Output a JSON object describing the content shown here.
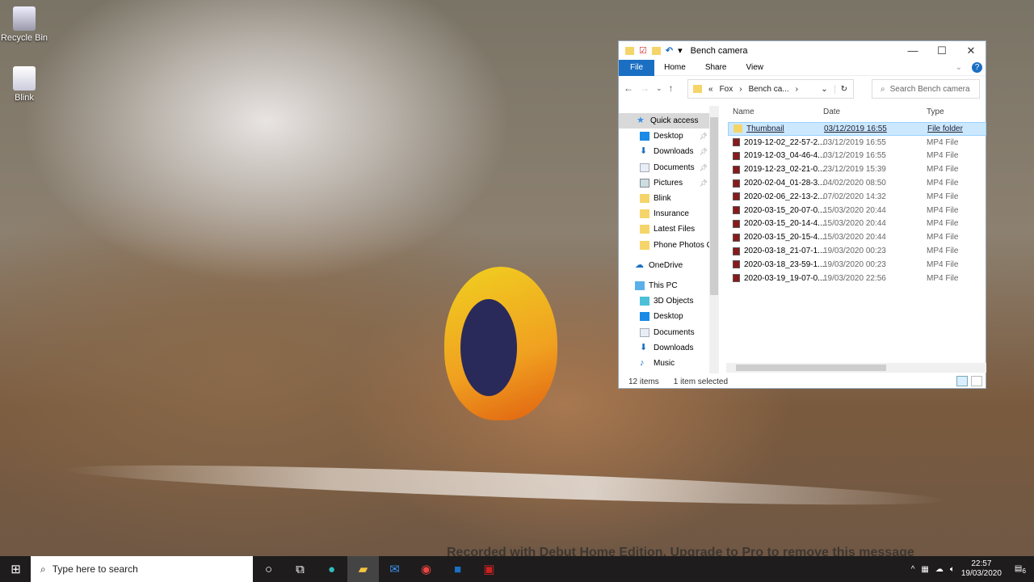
{
  "desktop": {
    "icons": [
      {
        "label": "Recycle Bin",
        "icon": "recycle-bin-icon"
      },
      {
        "label": "Blink",
        "icon": "file-icon"
      }
    ]
  },
  "explorer": {
    "title": "Bench camera",
    "ribbon_tabs": [
      "File",
      "Home",
      "Share",
      "View"
    ],
    "breadcrumb": {
      "overflow": "«",
      "items": [
        "Fox",
        "Bench ca..."
      ]
    },
    "search_placeholder": "Search Bench camera",
    "columns": [
      "Name",
      "Date",
      "Type"
    ],
    "nav": [
      {
        "label": "Quick access",
        "icon": "star-icon",
        "level": 0,
        "selected": true
      },
      {
        "label": "Desktop",
        "icon": "desktop-icon",
        "level": 1,
        "pinned": true
      },
      {
        "label": "Downloads",
        "icon": "download-icon",
        "level": 1,
        "pinned": true
      },
      {
        "label": "Documents",
        "icon": "documents-icon",
        "level": 1,
        "pinned": true
      },
      {
        "label": "Pictures",
        "icon": "pictures-icon",
        "level": 1,
        "pinned": true
      },
      {
        "label": "Blink",
        "icon": "folder-icon",
        "level": 1
      },
      {
        "label": "Insurance",
        "icon": "folder-icon",
        "level": 1
      },
      {
        "label": "Latest Files",
        "icon": "folder-icon",
        "level": 1
      },
      {
        "label": "Phone Photos O",
        "icon": "folder-icon",
        "level": 1
      },
      {
        "label": "OneDrive",
        "icon": "cloud-icon",
        "level": 0,
        "gap": true
      },
      {
        "label": "This PC",
        "icon": "pc-icon",
        "level": 0,
        "gap": true
      },
      {
        "label": "3D Objects",
        "icon": "cube-icon",
        "level": 1
      },
      {
        "label": "Desktop",
        "icon": "desktop-icon",
        "level": 1
      },
      {
        "label": "Documents",
        "icon": "documents-icon",
        "level": 1
      },
      {
        "label": "Downloads",
        "icon": "download-icon",
        "level": 1
      },
      {
        "label": "Music",
        "icon": "music-icon",
        "level": 1
      }
    ],
    "files": [
      {
        "name": "Thumbnail",
        "date": "03/12/2019 16:55",
        "type": "File folder",
        "selected": true
      },
      {
        "name": "2019-12-02_22-57-2...",
        "date": "03/12/2019 16:55",
        "type": "MP4 File"
      },
      {
        "name": "2019-12-03_04-46-4...",
        "date": "03/12/2019 16:55",
        "type": "MP4 File"
      },
      {
        "name": "2019-12-23_02-21-0...",
        "date": "23/12/2019 15:39",
        "type": "MP4 File"
      },
      {
        "name": "2020-02-04_01-28-3...",
        "date": "04/02/2020 08:50",
        "type": "MP4 File"
      },
      {
        "name": "2020-02-06_22-13-2...",
        "date": "07/02/2020 14:32",
        "type": "MP4 File"
      },
      {
        "name": "2020-03-15_20-07-0...",
        "date": "15/03/2020 20:44",
        "type": "MP4 File"
      },
      {
        "name": "2020-03-15_20-14-4...",
        "date": "15/03/2020 20:44",
        "type": "MP4 File"
      },
      {
        "name": "2020-03-15_20-15-4...",
        "date": "15/03/2020 20:44",
        "type": "MP4 File"
      },
      {
        "name": "2020-03-18_21-07-1...",
        "date": "19/03/2020 00:23",
        "type": "MP4 File"
      },
      {
        "name": "2020-03-18_23-59-1...",
        "date": "19/03/2020 00:23",
        "type": "MP4 File"
      },
      {
        "name": "2020-03-19_19-07-0...",
        "date": "19/03/2020 22:56",
        "type": "MP4 File"
      }
    ],
    "status": {
      "count": "12 items",
      "selection": "1 item selected"
    }
  },
  "taskbar": {
    "search_placeholder": "Type here to search",
    "time": "22:57",
    "date": "19/03/2020",
    "notifications": "6"
  },
  "watermark": "Recorded with Debut Home Edition. Upgrade to Pro to remove this message",
  "colors": {
    "accent": "#1a6fc3",
    "selection": "#cce8ff"
  }
}
